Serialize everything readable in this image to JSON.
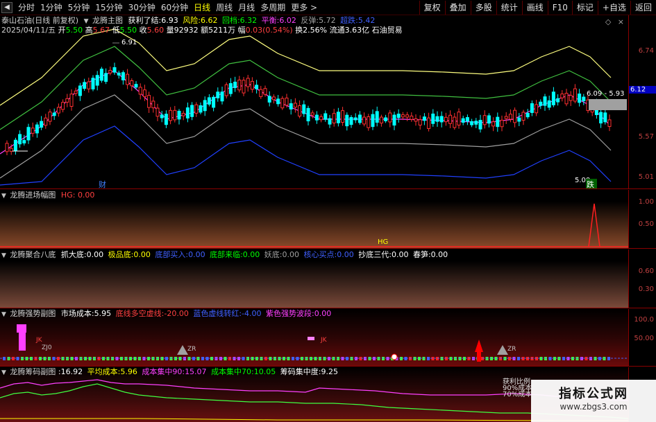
{
  "toolbar": {
    "periods": [
      "分时",
      "1分钟",
      "5分钟",
      "15分钟",
      "30分钟",
      "60分钟",
      "日线",
      "周线",
      "月线",
      "多周期",
      "更多"
    ],
    "active_period": "日线",
    "right_buttons": [
      "复权",
      "叠加",
      "多股",
      "统计",
      "画线",
      "F10",
      "标记",
      "+自选",
      "返回"
    ]
  },
  "header": {
    "stock": "泰山石油(日线 前复权)",
    "indicator": "龙腾主图",
    "indicator_values": [
      {
        "label": "获利了结:",
        "value": "6.93"
      },
      {
        "label": "风险:",
        "value": "6.62"
      },
      {
        "label": "回档:",
        "value": "6.32"
      },
      {
        "label": "平衡:",
        "value": "6.02"
      },
      {
        "label": "反弹:",
        "value": "5.72"
      },
      {
        "label": "超跌:",
        "value": "5.42"
      }
    ],
    "quote": {
      "date": "2025/04/11/五",
      "open_label": "开",
      "open": "5.50",
      "high_label": "高",
      "high": "5.67",
      "low_label": "低",
      "low": "5.50",
      "close_label": "收",
      "close": "5.60",
      "vol_label": "量",
      "vol": "92932",
      "amount_label": "额",
      "amount": "5211万",
      "change_label": "幅",
      "change": "0.03(0.54%)",
      "turnover_label": "换",
      "turnover": "2.56%",
      "float_label": "流通",
      "float": "3.63亿",
      "sector": "石油贸易"
    }
  },
  "main_axis": {
    "labels": [
      "6.74",
      "6.12",
      "5.57",
      "5.01"
    ],
    "current_price": "6.12"
  },
  "main_annotations": {
    "high": "6.91",
    "low": "5.00",
    "range": "6.09 - 5.93",
    "cai": "财",
    "die": "跌"
  },
  "panel2": {
    "title": "龙腾进场幅图",
    "hg_label": "HG:",
    "hg_value": "0.00",
    "hg_marker": "HG",
    "axis": [
      "1.00",
      "0.50"
    ]
  },
  "panel3": {
    "title": "龙腾聚合八底",
    "items": [
      {
        "label": "抓大底:",
        "value": "0.00"
      },
      {
        "label": "极品底:",
        "value": "0.00"
      },
      {
        "label": "底部买入:",
        "value": "0.00"
      },
      {
        "label": "底部来临:",
        "value": "0.00"
      },
      {
        "label": "妖底:",
        "value": "0.00"
      },
      {
        "label": "核心买点:",
        "value": "0.00"
      },
      {
        "label": "抄底三代:",
        "value": "0.00"
      },
      {
        "label": "春笋:",
        "value": "0.00"
      }
    ],
    "axis": [
      "0.60",
      "0.30"
    ]
  },
  "panel4": {
    "title": "龙腾强势副图",
    "items": [
      {
        "label": "市场成本:",
        "value": "5.95"
      },
      {
        "label": "底线多空虚线:",
        "value": "-20.00"
      },
      {
        "label": "蓝色虚线转红:",
        "value": "-4.00"
      },
      {
        "label": "紫色强势波段:",
        "value": "0.00"
      }
    ],
    "markers": [
      "JK",
      "ZJ0",
      "ZR",
      "JK",
      "ZR"
    ],
    "axis": [
      "100.0",
      "50.00"
    ]
  },
  "panel5": {
    "title": "龙腾筹码副图",
    "items": [
      {
        "label": ":",
        "value": "16.92"
      },
      {
        "label": "平均成本:",
        "value": "5.96"
      },
      {
        "label": "成本集中90:",
        "value": "15.07"
      },
      {
        "label": "成本集中70:",
        "value": "10.05"
      },
      {
        "label": "筹码集中度:",
        "value": "9.25"
      }
    ],
    "notes": [
      "获利比例",
      "90%成本",
      "70%成本"
    ]
  },
  "watermark": {
    "main": "指标公式网",
    "url": "www.zbgs3.com"
  },
  "colors": {
    "up": "#ff3030",
    "down": "#00ffff",
    "band_yellow": "#ffff80",
    "band_green": "#40c040",
    "band_magenta": "#ff40ff",
    "band_blue": "#2040ff"
  }
}
